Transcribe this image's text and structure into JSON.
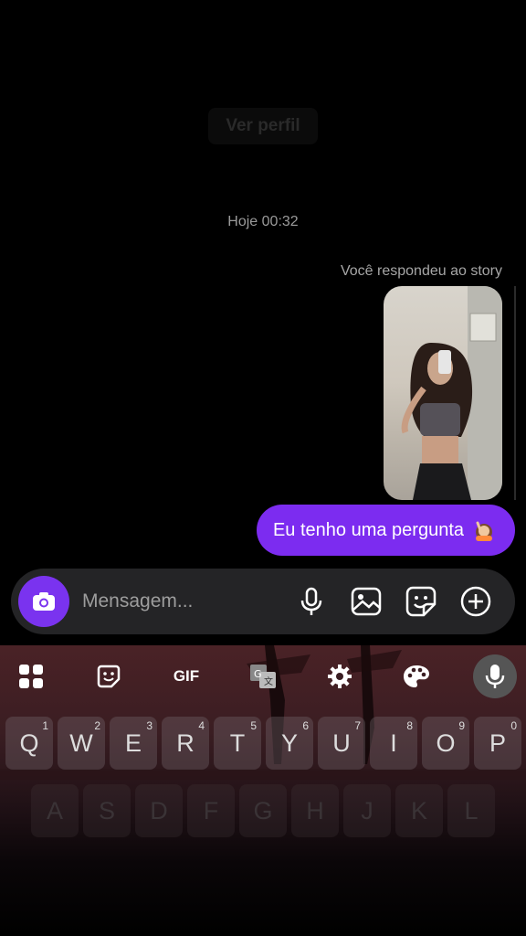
{
  "header": {
    "ver_perfil_label": "Ver perfil"
  },
  "chat": {
    "timestamp": "Hoje 00:32",
    "story_reply_label": "Você respondeu ao story",
    "message_text": "Eu tenho uma pergunta"
  },
  "composer": {
    "placeholder": "Mensagem...",
    "icons": [
      "camera-icon",
      "microphone-icon",
      "image-icon",
      "sticker-icon",
      "add-icon"
    ]
  },
  "keyboard": {
    "toolbar": {
      "gif_label": "GIF"
    },
    "row1": [
      {
        "key": "Q",
        "num": "1"
      },
      {
        "key": "W",
        "num": "2"
      },
      {
        "key": "E",
        "num": "3"
      },
      {
        "key": "R",
        "num": "4"
      },
      {
        "key": "T",
        "num": "5"
      },
      {
        "key": "Y",
        "num": "6"
      },
      {
        "key": "U",
        "num": "7"
      },
      {
        "key": "I",
        "num": "8"
      },
      {
        "key": "O",
        "num": "9"
      },
      {
        "key": "P",
        "num": "0"
      }
    ],
    "row2": [
      "A",
      "S",
      "D",
      "F",
      "G",
      "H",
      "J",
      "K",
      "L"
    ]
  },
  "colors": {
    "accent": "#7c2cf0",
    "composer_bg": "#242426",
    "background": "#000000"
  }
}
